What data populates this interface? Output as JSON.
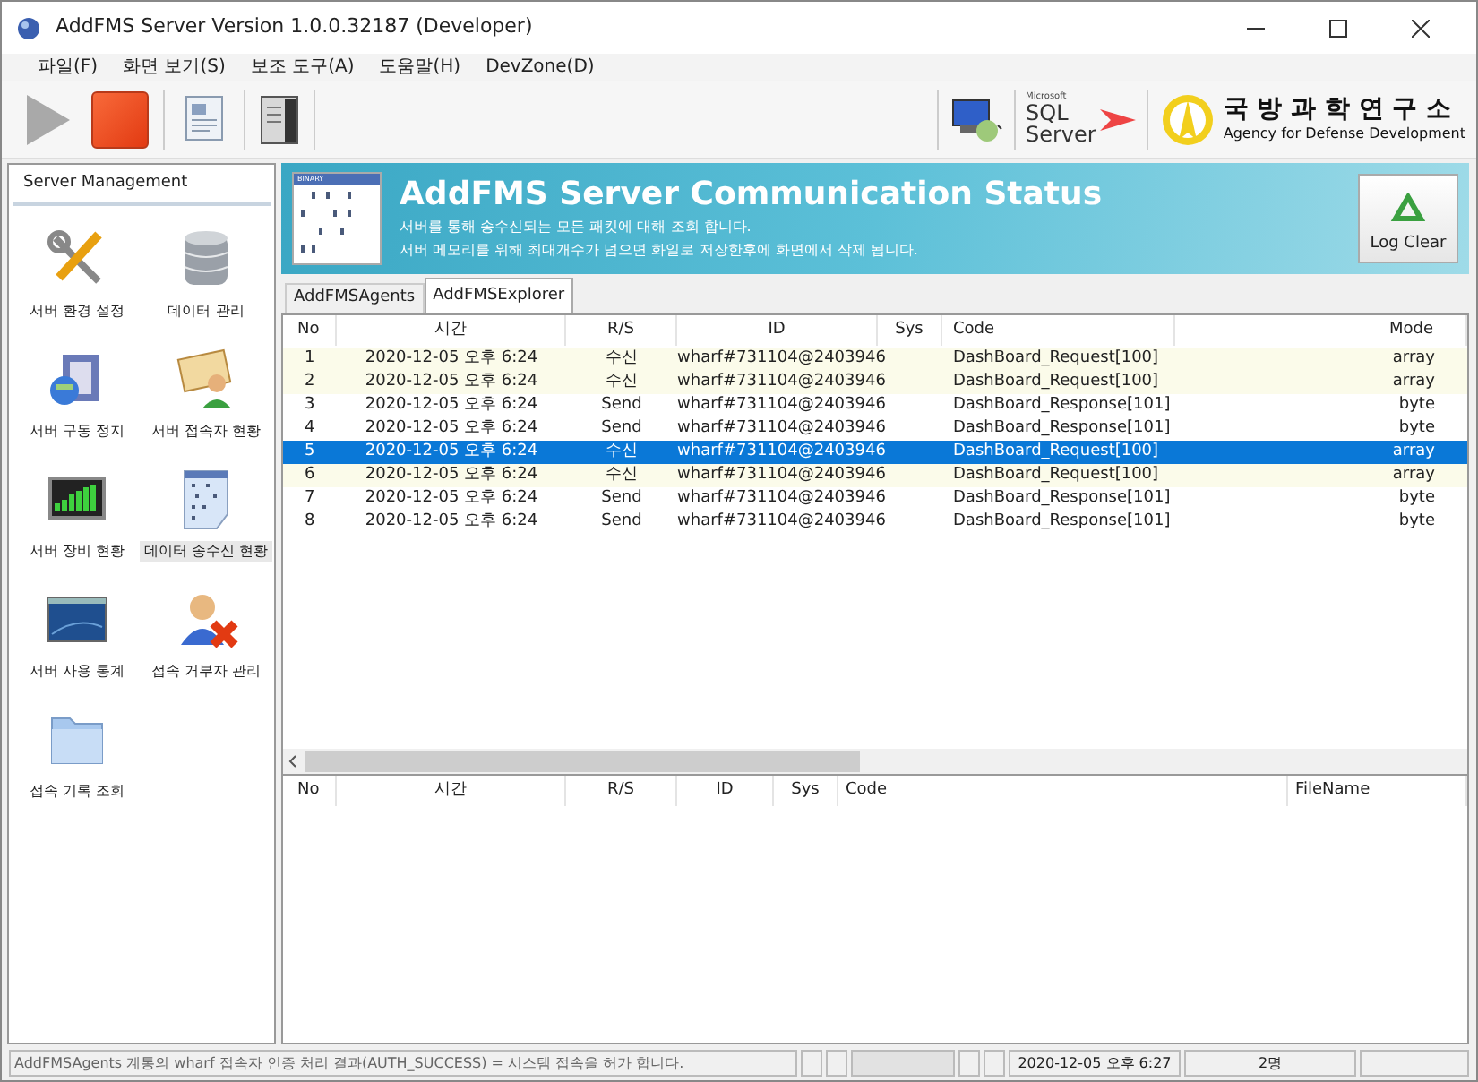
{
  "window": {
    "title": "AddFMS Server Version 1.0.0.32187 (Developer)"
  },
  "menu": [
    {
      "label": "파일(F)"
    },
    {
      "label": "화면 보기(S)"
    },
    {
      "label": "보조 도구(A)"
    },
    {
      "label": "도움말(H)"
    },
    {
      "label": "DevZone(D)"
    }
  ],
  "toolbar": {
    "sql_logo": {
      "small": "Microsoft",
      "line1": "SQL",
      "line2": "Server"
    },
    "agency_logo": {
      "korean": "국 방 과 학 연 구 소",
      "english": "Agency for Defense Development"
    }
  },
  "sidebar": {
    "title": "Server Management",
    "items": [
      {
        "label": "서버 환경 설정",
        "kind": "tools",
        "selected": false
      },
      {
        "label": "데이터 관리",
        "kind": "database",
        "selected": false
      },
      {
        "label": "서버 구동 정지",
        "kind": "server",
        "selected": false
      },
      {
        "label": "서버 접속자 현황",
        "kind": "user-book",
        "selected": false
      },
      {
        "label": "서버 장비 현황",
        "kind": "monitor",
        "selected": false
      },
      {
        "label": "데이터 송수신 현황",
        "kind": "binary",
        "selected": true
      },
      {
        "label": "서버 사용 통계",
        "kind": "window",
        "selected": false
      },
      {
        "label": "접속 거부자 관리",
        "kind": "user-x",
        "selected": false
      },
      {
        "label": "접속 기록 조회",
        "kind": "folder",
        "selected": false
      }
    ]
  },
  "banner": {
    "binary_label": "BINARY",
    "title": "AddFMS Server Communication Status",
    "line1": "서버를 통해 송수신되는 모든 패킷에 대해 조회 합니다.",
    "line2": "서버 메모리를 위해 최대개수가 넘으면 화일로 저장한후에 화면에서 삭제 됩니다.",
    "button": "Log Clear"
  },
  "tabs": [
    {
      "label": "AddFMSAgents",
      "selected": false
    },
    {
      "label": "AddFMSExplorer",
      "selected": true
    }
  ],
  "packets": {
    "columns": [
      "No",
      "시간",
      "R/S",
      "ID",
      "Sys",
      "Code",
      "Mode"
    ],
    "rows": [
      {
        "no": "1",
        "time": "2020-12-05 오후 6:24",
        "rs": "수신",
        "id": "wharf#731104@2403946",
        "code": "DashBoard_Request[100]",
        "mode": "array",
        "kind": "receive",
        "selected": false
      },
      {
        "no": "2",
        "time": "2020-12-05 오후 6:24",
        "rs": "수신",
        "id": "wharf#731104@2403946",
        "code": "DashBoard_Request[100]",
        "mode": "array",
        "kind": "receive",
        "selected": false
      },
      {
        "no": "3",
        "time": "2020-12-05 오후 6:24",
        "rs": "Send",
        "id": "wharf#731104@2403946",
        "code": "DashBoard_Response[101]",
        "mode": "byte",
        "kind": "send",
        "selected": false
      },
      {
        "no": "4",
        "time": "2020-12-05 오후 6:24",
        "rs": "Send",
        "id": "wharf#731104@2403946",
        "code": "DashBoard_Response[101]",
        "mode": "byte",
        "kind": "send",
        "selected": false
      },
      {
        "no": "5",
        "time": "2020-12-05 오후 6:24",
        "rs": "수신",
        "id": "wharf#731104@2403946",
        "code": "DashBoard_Request[100]",
        "mode": "array",
        "selected": true
      },
      {
        "no": "6",
        "time": "2020-12-05 오후 6:24",
        "rs": "수신",
        "id": "wharf#731104@2403946",
        "code": "DashBoard_Request[100]",
        "mode": "array",
        "kind": "receive",
        "selected": false
      },
      {
        "no": "7",
        "time": "2020-12-05 오후 6:24",
        "rs": "Send",
        "id": "wharf#731104@2403946",
        "code": "DashBoard_Response[101]",
        "mode": "byte",
        "kind": "send",
        "selected": false
      },
      {
        "no": "8",
        "time": "2020-12-05 오후 6:24",
        "rs": "Send",
        "id": "wharf#731104@2403946",
        "code": "DashBoard_Response[101]",
        "mode": "byte",
        "kind": "send",
        "selected": false
      }
    ]
  },
  "files": {
    "columns": [
      "No",
      "시간",
      "R/S",
      "ID",
      "Sys",
      "Code",
      "FileName"
    ]
  },
  "status_bar": {
    "message": "AddFMSAgents 계통의 wharf 접속자 인증 처리 결과(AUTH_SUCCESS) = 시스템 접속을 허가 합니다.",
    "datetime": "2020-12-05 오후 6:27",
    "users": "2명"
  }
}
